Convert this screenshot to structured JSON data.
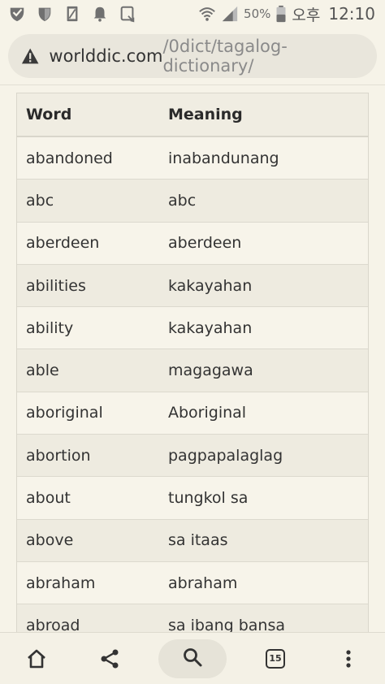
{
  "statusbar": {
    "battery": "50%",
    "ampm": "오후",
    "time": "12:10",
    "icons": [
      "shield-check-icon",
      "shield-icon",
      "file-icon",
      "bell-icon",
      "screen-icon",
      "wifi-icon",
      "signal-icon",
      "battery-icon"
    ]
  },
  "urlbar": {
    "domain": "worlddic.com",
    "path": "/0dict/tagalog-dictionary/",
    "icon": "warning-icon"
  },
  "table": {
    "headers": {
      "word": "Word",
      "meaning": "Meaning"
    },
    "rows": [
      {
        "word": "abandoned",
        "meaning": "inabandunang"
      },
      {
        "word": "abc",
        "meaning": "abc"
      },
      {
        "word": "aberdeen",
        "meaning": "aberdeen"
      },
      {
        "word": "abilities",
        "meaning": "kakayahan"
      },
      {
        "word": "ability",
        "meaning": "kakayahan"
      },
      {
        "word": "able",
        "meaning": "magagawa"
      },
      {
        "word": "aboriginal",
        "meaning": "Aboriginal"
      },
      {
        "word": "abortion",
        "meaning": "pagpapalaglag"
      },
      {
        "word": "about",
        "meaning": "tungkol sa"
      },
      {
        "word": "above",
        "meaning": "sa itaas"
      },
      {
        "word": "abraham",
        "meaning": "abraham"
      },
      {
        "word": "abroad",
        "meaning": "sa ibang bansa"
      }
    ]
  },
  "bottomnav": {
    "tab_count": "15",
    "icons": [
      "home-icon",
      "share-icon",
      "search-icon",
      "tabs-icon",
      "more-icon"
    ]
  }
}
